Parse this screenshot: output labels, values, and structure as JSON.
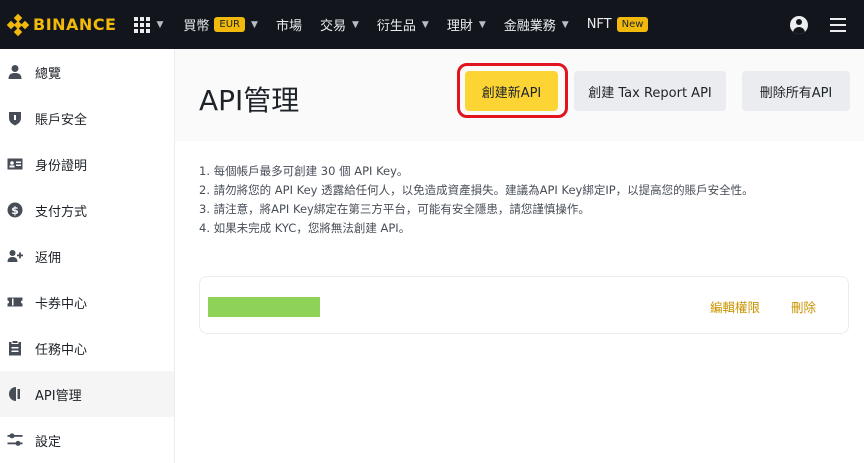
{
  "brand": {
    "name": "BINANCE",
    "color": "#f0b90b"
  },
  "nav": {
    "items": [
      {
        "label": "買幣",
        "badge": "EUR",
        "has_caret": true
      },
      {
        "label": "市場",
        "has_caret": false
      },
      {
        "label": "交易",
        "has_caret": true
      },
      {
        "label": "衍生品",
        "has_caret": true
      },
      {
        "label": "理財",
        "has_caret": true
      },
      {
        "label": "金融業務",
        "has_caret": true
      },
      {
        "label": "NFT",
        "badge": "New",
        "has_caret": false
      }
    ],
    "icons": {
      "apps": "apps-grid-icon",
      "user": "user-circle-icon",
      "menu": "hamburger-menu-icon"
    }
  },
  "sidebar": {
    "items": [
      {
        "label": "總覽",
        "icon": "person-icon"
      },
      {
        "label": "賬戶安全",
        "icon": "shield-icon"
      },
      {
        "label": "身份證明",
        "icon": "id-card-icon"
      },
      {
        "label": "支付方式",
        "icon": "dollar-icon"
      },
      {
        "label": "返佣",
        "icon": "add-user-icon"
      },
      {
        "label": "卡券中心",
        "icon": "ticket-icon"
      },
      {
        "label": "任務中心",
        "icon": "clipboard-icon"
      },
      {
        "label": "API管理",
        "icon": "api-icon",
        "active": true
      },
      {
        "label": "設定",
        "icon": "sliders-icon"
      }
    ]
  },
  "header": {
    "title": "API管理",
    "buttons": {
      "create": "創建新API",
      "tax_report": "創建 Tax Report API",
      "delete_all": "刪除所有API"
    },
    "highlight_color": "#e2141f"
  },
  "notes": [
    "1. 每個帳戶最多可創建 30 個 API Key。",
    "2. 請勿將您的 API Key 透露給任何人，以免造成資產損失。建議為API Key綁定IP，以提高您的賬戶安全性。",
    "3. 請注意，將API Key綁定在第三方平台，可能有安全隱患，請您謹慎操作。",
    "4. 如果未完成 KYC，您將無法創建 API。"
  ],
  "api_entry": {
    "redacted_label_color": "#8ed357",
    "edit_label": "編輯權限",
    "delete_label": "刪除"
  }
}
